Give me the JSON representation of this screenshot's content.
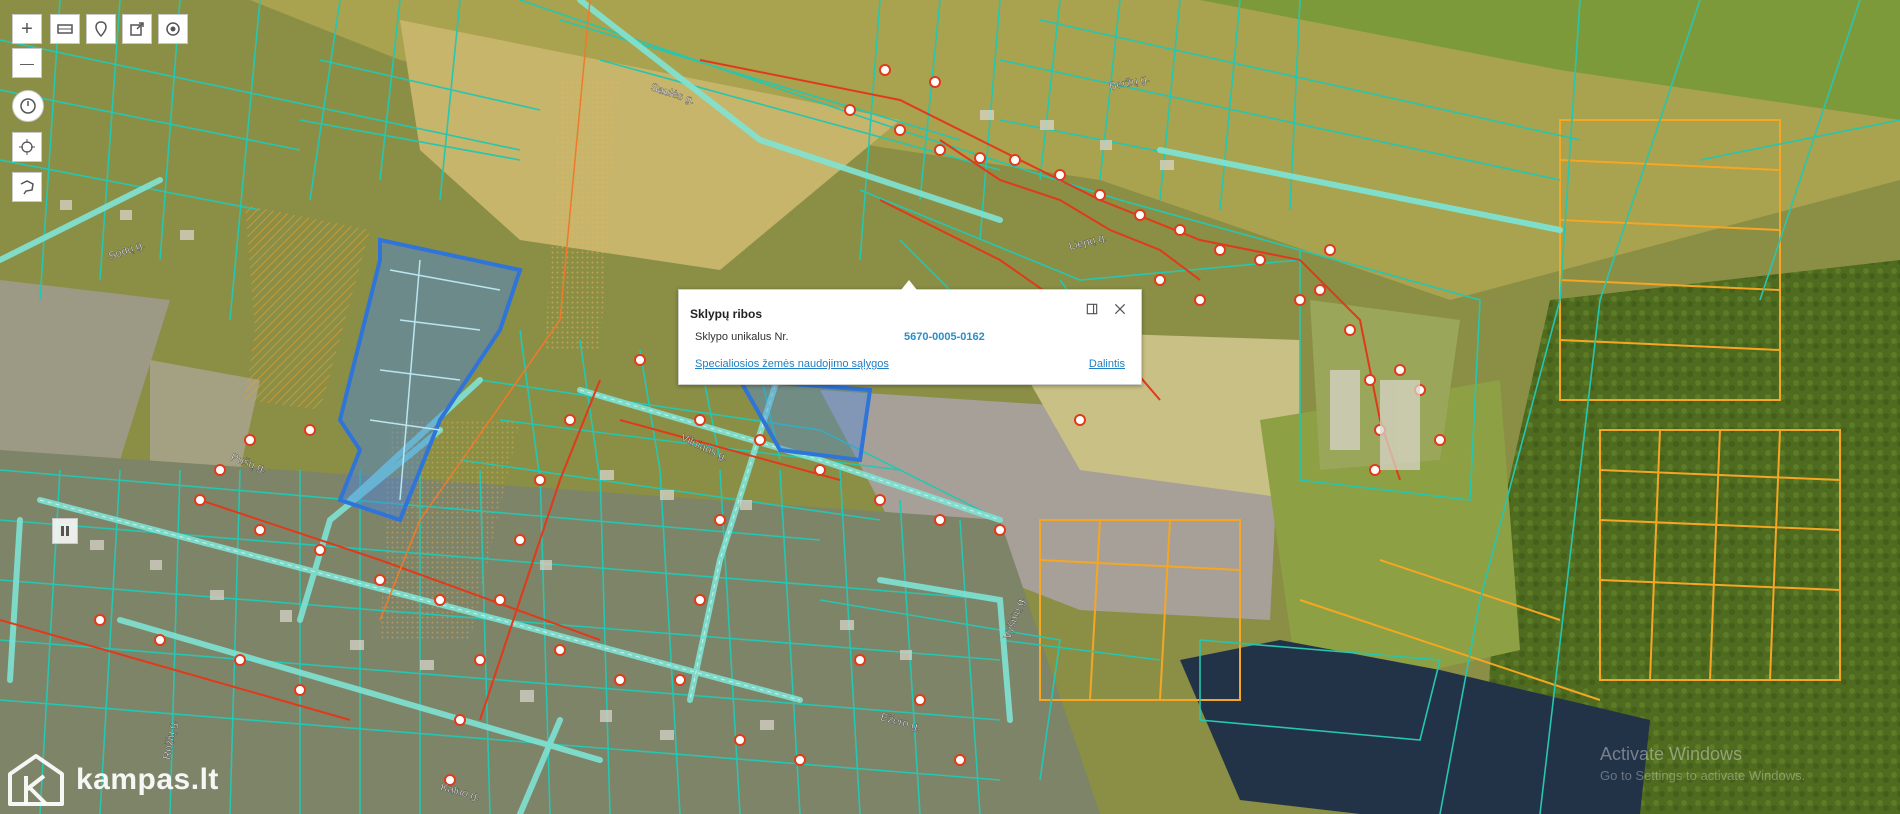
{
  "popup": {
    "title": "Sklypų ribos",
    "label": "Sklypo unikalus Nr.",
    "value": "5670-0005-0162",
    "link": "Specialiosios žemės naudojimo sąlygos",
    "share": "Dalintis"
  },
  "toolbar": {
    "zoom_in": "+",
    "zoom_out": "—"
  },
  "brand": "kampas.lt",
  "watermark": {
    "line1": "Activate Windows",
    "line2": "Go to Settings to activate Windows."
  },
  "streets": [
    "Saulės g.",
    "Beržų g.",
    "Liepų g.",
    "Vilniaus g.",
    "Pušų g.",
    "Sodų g.",
    "Vyšnių g.",
    "Ežero g.",
    "Rožių g.",
    "Kalno g."
  ],
  "colors": {
    "parcel": "#26c6b0",
    "road": "#7fe3d4",
    "utility": "#e03a1a",
    "restricted": "#f5a623",
    "selected": "#2f74d8",
    "water": "#1e3046"
  }
}
